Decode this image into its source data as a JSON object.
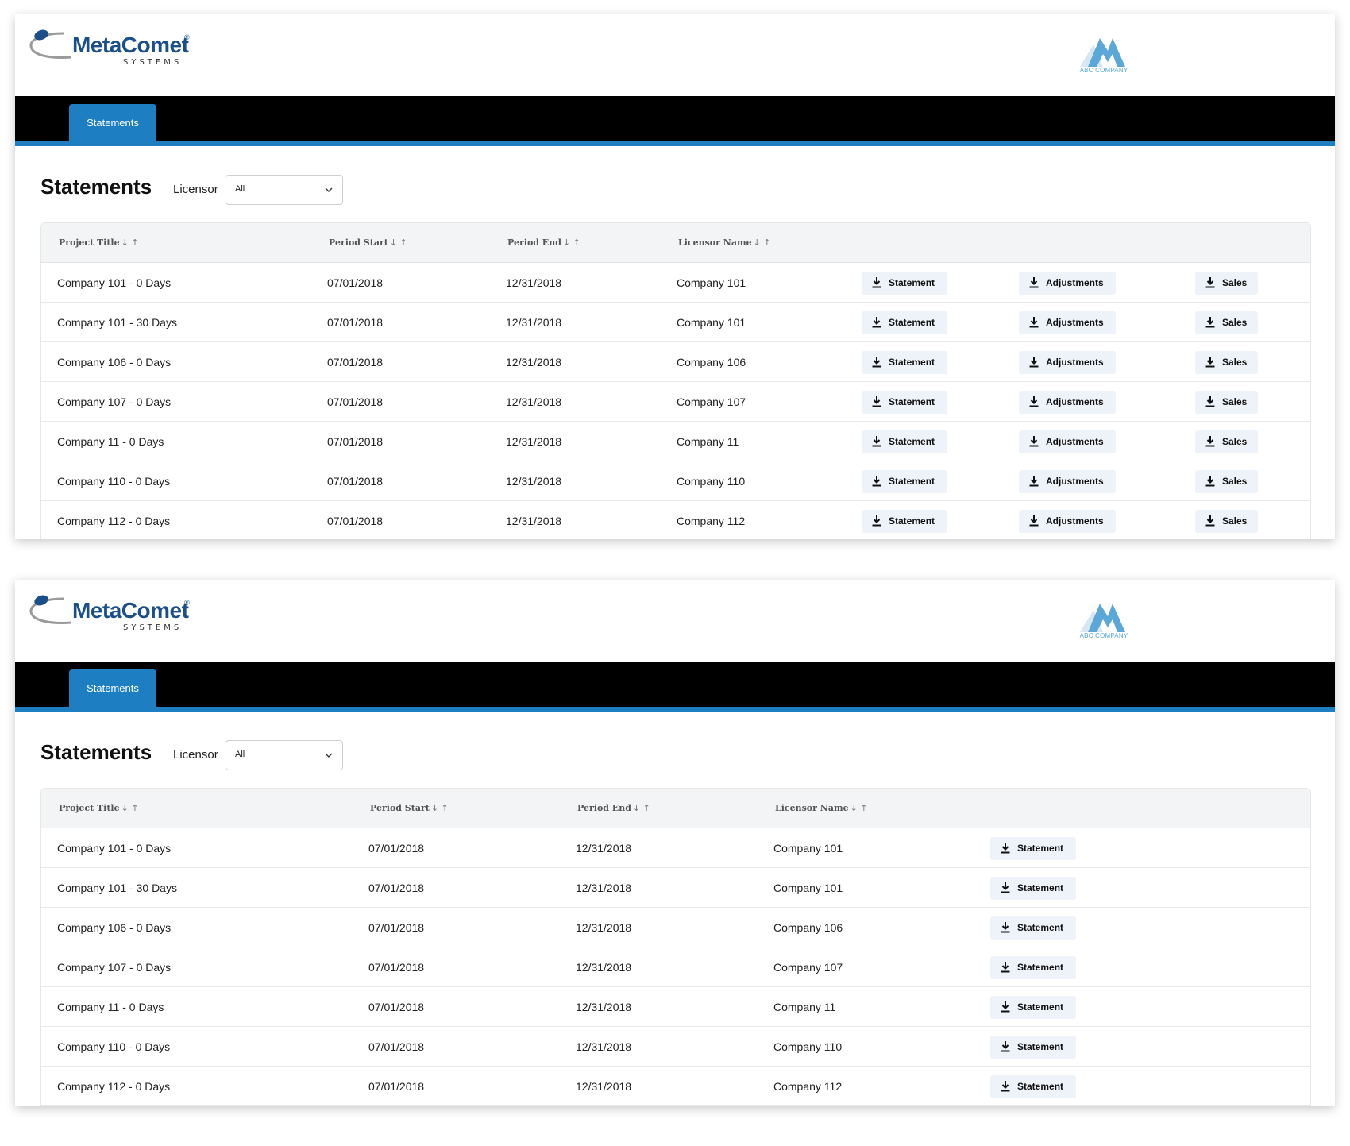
{
  "brand": {
    "name": "MetaComet",
    "registered": "®",
    "systems": "SYSTEMS",
    "client_logo_text": "ABC COMPANY",
    "primary_color": "#1d7fc1",
    "navbar_color": "#000000"
  },
  "panel1": {
    "nav": {
      "tab_label": "Statements"
    },
    "page_title": "Statements",
    "filter": {
      "label": "Licensor",
      "value": "All"
    },
    "columns": [
      {
        "label": "Project Title",
        "sort": "↓ ↑"
      },
      {
        "label": "Period Start",
        "sort": "↓ ↑"
      },
      {
        "label": "Period End",
        "sort": "↓ ↑"
      },
      {
        "label": "Licensor Name",
        "sort": "↓ ↑"
      }
    ],
    "buttons": {
      "statement": "Statement",
      "adjustments": "Adjustments",
      "sales": "Sales"
    },
    "rows": [
      {
        "project": "Company 101 - 0 Days",
        "start": "07/01/2018",
        "end": "12/31/2018",
        "licensor": "Company 101"
      },
      {
        "project": "Company 101 - 30 Days",
        "start": "07/01/2018",
        "end": "12/31/2018",
        "licensor": "Company 101"
      },
      {
        "project": "Company 106 - 0 Days",
        "start": "07/01/2018",
        "end": "12/31/2018",
        "licensor": "Company 106"
      },
      {
        "project": "Company 107 - 0 Days",
        "start": "07/01/2018",
        "end": "12/31/2018",
        "licensor": "Company 107"
      },
      {
        "project": "Company 11 - 0 Days",
        "start": "07/01/2018",
        "end": "12/31/2018",
        "licensor": "Company 11"
      },
      {
        "project": "Company 110 - 0 Days",
        "start": "07/01/2018",
        "end": "12/31/2018",
        "licensor": "Company 110"
      },
      {
        "project": "Company 112 - 0 Days",
        "start": "07/01/2018",
        "end": "12/31/2018",
        "licensor": "Company 112"
      }
    ]
  },
  "panel2": {
    "nav": {
      "tab_label": "Statements"
    },
    "page_title": "Statements",
    "filter": {
      "label": "Licensor",
      "value": "All"
    },
    "columns": [
      {
        "label": "Project Title",
        "sort": "↓ ↑"
      },
      {
        "label": "Period Start",
        "sort": "↓ ↑"
      },
      {
        "label": "Period End",
        "sort": "↓ ↑"
      },
      {
        "label": "Licensor Name",
        "sort": "↓ ↑"
      }
    ],
    "buttons": {
      "statement": "Statement"
    },
    "rows": [
      {
        "project": "Company 101 - 0 Days",
        "start": "07/01/2018",
        "end": "12/31/2018",
        "licensor": "Company 101"
      },
      {
        "project": "Company 101 - 30 Days",
        "start": "07/01/2018",
        "end": "12/31/2018",
        "licensor": "Company 101"
      },
      {
        "project": "Company 106 - 0 Days",
        "start": "07/01/2018",
        "end": "12/31/2018",
        "licensor": "Company 106"
      },
      {
        "project": "Company 107 - 0 Days",
        "start": "07/01/2018",
        "end": "12/31/2018",
        "licensor": "Company 107"
      },
      {
        "project": "Company 11 - 0 Days",
        "start": "07/01/2018",
        "end": "12/31/2018",
        "licensor": "Company 11"
      },
      {
        "project": "Company 110 - 0 Days",
        "start": "07/01/2018",
        "end": "12/31/2018",
        "licensor": "Company 110"
      },
      {
        "project": "Company 112 - 0 Days",
        "start": "07/01/2018",
        "end": "12/31/2018",
        "licensor": "Company 112"
      }
    ]
  }
}
